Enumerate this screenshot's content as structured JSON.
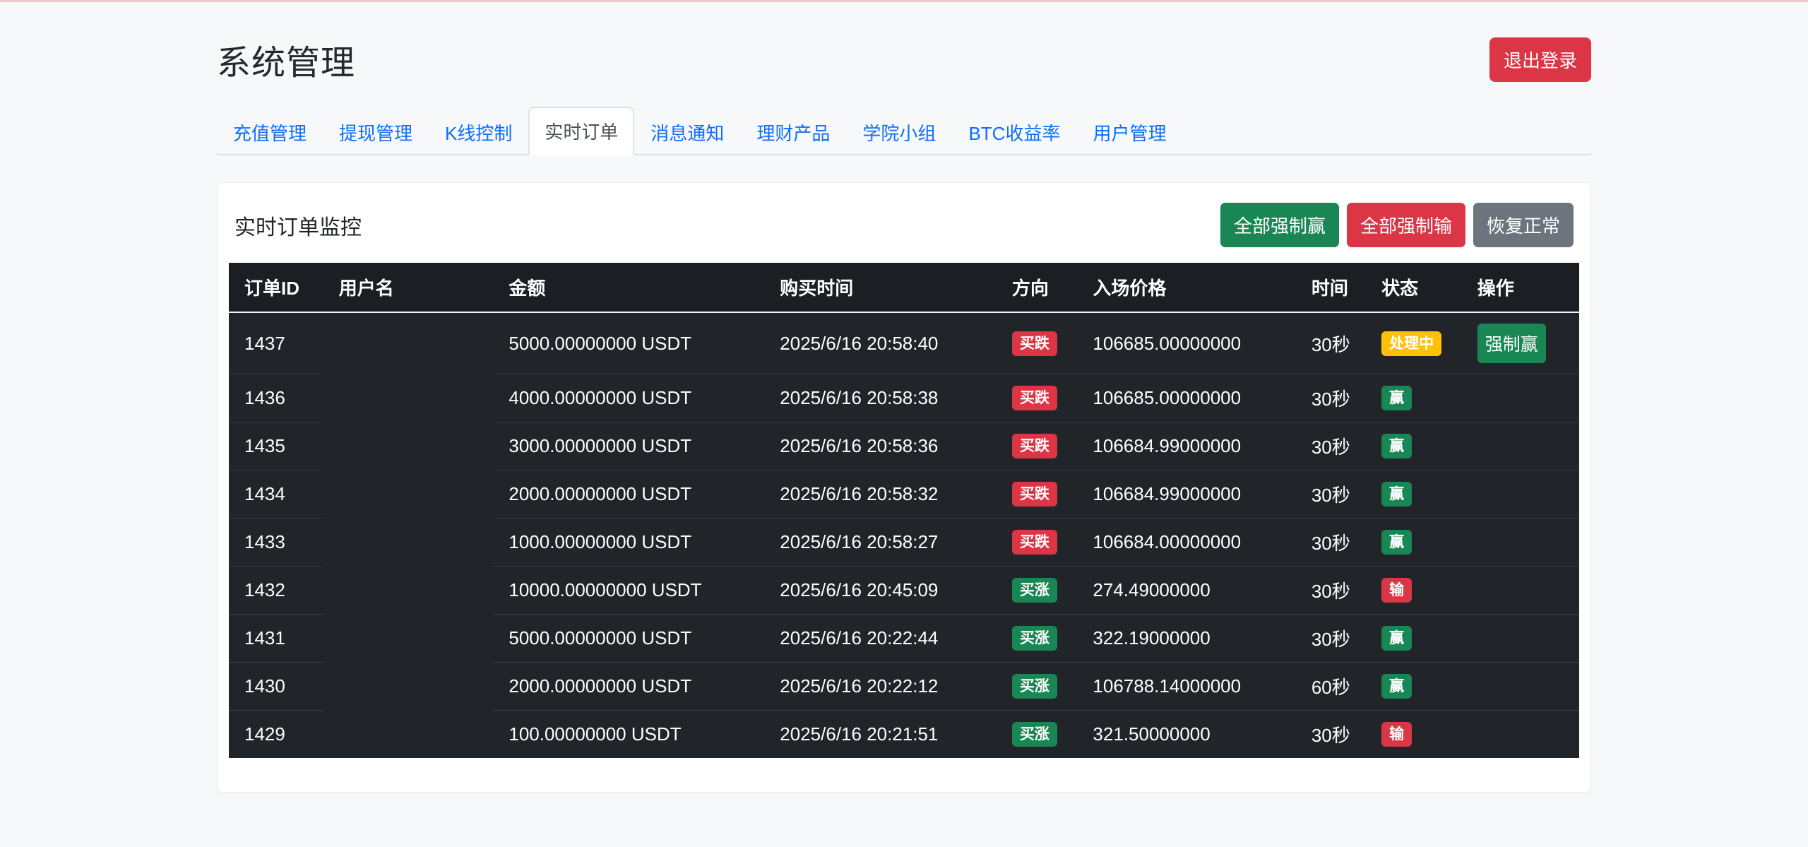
{
  "page": {
    "title": "系统管理",
    "logout_label": "退出登录"
  },
  "tabs": [
    {
      "label": "充值管理",
      "active": false
    },
    {
      "label": "提现管理",
      "active": false
    },
    {
      "label": "K线控制",
      "active": false
    },
    {
      "label": "实时订单",
      "active": true
    },
    {
      "label": "消息通知",
      "active": false
    },
    {
      "label": "理财产品",
      "active": false
    },
    {
      "label": "学院小组",
      "active": false
    },
    {
      "label": "BTC收益率",
      "active": false
    },
    {
      "label": "用户管理",
      "active": false
    }
  ],
  "panel": {
    "heading": "实时订单监控",
    "actions": [
      {
        "label": "全部强制赢",
        "color": "green"
      },
      {
        "label": "全部强制输",
        "color": "red"
      },
      {
        "label": "恢复正常",
        "color": "gray"
      }
    ]
  },
  "table": {
    "columns": [
      "订单ID",
      "用户名",
      "金额",
      "购买时间",
      "方向",
      "入场价格",
      "时间",
      "状态",
      "操作"
    ],
    "column_widths_pct": [
      7.0,
      12.6,
      20.1,
      17.2,
      6.0,
      16.2,
      5.2,
      7.1,
      8.7
    ],
    "rows": [
      {
        "id": "1437",
        "username": "",
        "amount": "5000.00000000 USDT",
        "buy_time": "2025/6/16 20:58:40",
        "direction": "买跌",
        "direction_type": "down",
        "entry_price": "106685.00000000",
        "duration": "30秒",
        "status": "处理中",
        "status_type": "processing",
        "action": "强制赢"
      },
      {
        "id": "1436",
        "username": "",
        "amount": "4000.00000000 USDT",
        "buy_time": "2025/6/16 20:58:38",
        "direction": "买跌",
        "direction_type": "down",
        "entry_price": "106685.00000000",
        "duration": "30秒",
        "status": "赢",
        "status_type": "win",
        "action": ""
      },
      {
        "id": "1435",
        "username": "",
        "amount": "3000.00000000 USDT",
        "buy_time": "2025/6/16 20:58:36",
        "direction": "买跌",
        "direction_type": "down",
        "entry_price": "106684.99000000",
        "duration": "30秒",
        "status": "赢",
        "status_type": "win",
        "action": ""
      },
      {
        "id": "1434",
        "username": "",
        "amount": "2000.00000000 USDT",
        "buy_time": "2025/6/16 20:58:32",
        "direction": "买跌",
        "direction_type": "down",
        "entry_price": "106684.99000000",
        "duration": "30秒",
        "status": "赢",
        "status_type": "win",
        "action": ""
      },
      {
        "id": "1433",
        "username": "",
        "amount": "1000.00000000 USDT",
        "buy_time": "2025/6/16 20:58:27",
        "direction": "买跌",
        "direction_type": "down",
        "entry_price": "106684.00000000",
        "duration": "30秒",
        "status": "赢",
        "status_type": "win",
        "action": ""
      },
      {
        "id": "1432",
        "username": "",
        "amount": "10000.00000000 USDT",
        "buy_time": "2025/6/16 20:45:09",
        "direction": "买涨",
        "direction_type": "up",
        "entry_price": "274.49000000",
        "duration": "30秒",
        "status": "输",
        "status_type": "lose",
        "action": ""
      },
      {
        "id": "1431",
        "username": "",
        "amount": "5000.00000000 USDT",
        "buy_time": "2025/6/16 20:22:44",
        "direction": "买涨",
        "direction_type": "up",
        "entry_price": "322.19000000",
        "duration": "30秒",
        "status": "赢",
        "status_type": "win",
        "action": ""
      },
      {
        "id": "1430",
        "username": "",
        "amount": "2000.00000000 USDT",
        "buy_time": "2025/6/16 20:22:12",
        "direction": "买涨",
        "direction_type": "up",
        "entry_price": "106788.14000000",
        "duration": "60秒",
        "status": "赢",
        "status_type": "win",
        "action": ""
      },
      {
        "id": "1429",
        "username": "",
        "amount": "100.00000000 USDT",
        "buy_time": "2025/6/16 20:21:51",
        "direction": "买涨",
        "direction_type": "up",
        "entry_price": "321.50000000",
        "duration": "30秒",
        "status": "输",
        "status_type": "lose",
        "action": ""
      }
    ]
  },
  "colors": {
    "accent_bar": "#eec9cd",
    "link_blue": "#0d6efd",
    "success_green": "#198754",
    "danger_red": "#dc3545",
    "warning_yellow": "#ffc107",
    "neutral_gray": "#6c757d",
    "table_dark": "#212529",
    "table_head_dark": "#1b1f23"
  }
}
